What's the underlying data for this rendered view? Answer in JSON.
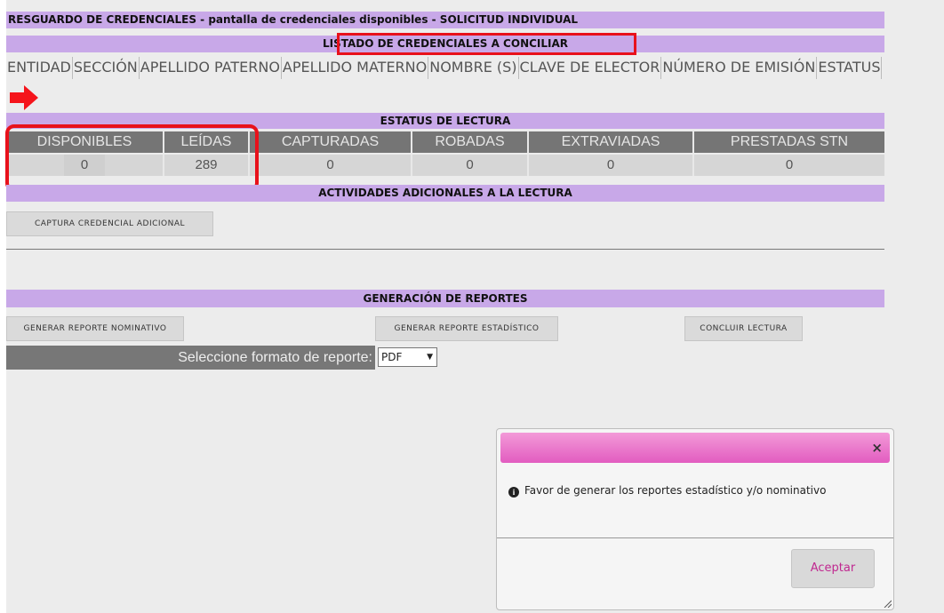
{
  "page": {
    "title": "RESGUARDO DE CREDENCIALES - pantalla de credenciales disponibles - SOLICITUD INDIVIDUAL",
    "list_title": "LISTADO DE CREDENCIALES A CONCILIAR",
    "columns": [
      "ENTIDAD",
      "SECCIÓN",
      "APELLIDO PATERNO",
      "APELLIDO MATERNO",
      "NOMBRE (S)",
      "CLAVE DE ELECTOR",
      "NÚMERO DE EMISIÓN",
      "ESTATUS"
    ],
    "arrow_icon": "right-arrow-icon"
  },
  "status": {
    "title": "ESTATUS DE LECTURA",
    "headers": [
      "DISPONIBLES",
      "LEÍDAS",
      "CAPTURADAS",
      "ROBADAS",
      "EXTRAVIADAS",
      "PRESTADAS STN"
    ],
    "values": [
      "0",
      "289",
      "0",
      "0",
      "0",
      "0"
    ]
  },
  "activities": {
    "title": "ACTIVIDADES ADICIONALES A LA LECTURA",
    "capture_button": "CAPTURA CREDENCIAL ADICIONAL"
  },
  "reports": {
    "title": "GENERACIÓN DE REPORTES",
    "nominal_button": "GENERAR REPORTE NOMINATIVO",
    "statistic_button": "GENERAR REPORTE ESTADÍSTICO",
    "conclude_button": "CONCLUIR LECTURA",
    "format_label": "Seleccione formato de reporte:",
    "format_value": "PDF"
  },
  "dialog": {
    "close_label": "×",
    "message": "Favor de generar los reportes estadístico y/o nominativo",
    "ok_label": "Aceptar",
    "header_color": "#e25cc0"
  },
  "colors": {
    "section_bar": "#c8a8e8",
    "highlight": "#e8111b"
  }
}
